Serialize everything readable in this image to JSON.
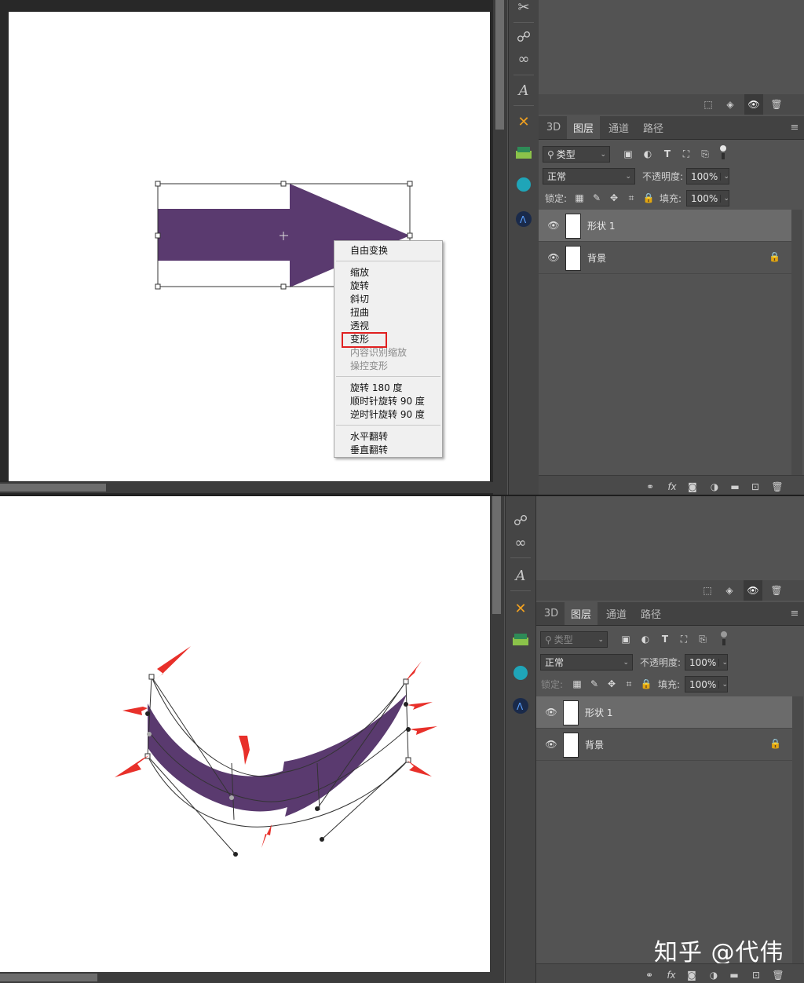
{
  "colors": {
    "arrow_fill": "#5a3a6f",
    "annotation_red": "#e8302a",
    "panel_bg": "#535353",
    "selected_layer": "#6b6b6b",
    "highlight_box": "#e02020"
  },
  "icons": {
    "tools": [
      "tool-brush-icon",
      "tool-path-icon",
      "tool-cc-icon",
      "tool-type-icon",
      "tool-brushes-icon",
      "tool-layers3d-icon",
      "tool-ball-icon",
      "tool-app-icon"
    ],
    "layer_filters": [
      "image-filter-icon",
      "adjustment-filter-icon",
      "type-filter-icon",
      "shape-filter-icon",
      "smartobject-filter-icon",
      "filter-toggle-icon"
    ],
    "bottom_bar": [
      "link-icon",
      "fx-icon",
      "mask-icon",
      "adjustment-icon",
      "folder-icon",
      "new-layer-icon",
      "trash-icon"
    ]
  },
  "top": {
    "context_menu": {
      "items_group1": [
        "自由变换"
      ],
      "items_group2": [
        "缩放",
        "旋转",
        "斜切",
        "扭曲",
        "透视",
        "变形"
      ],
      "items_group2_disabled": [
        "内容识别缩放",
        "操控变形"
      ],
      "items_group3": [
        "旋转 180 度",
        "顺时针旋转 90 度",
        "逆时针旋转 90 度"
      ],
      "items_group4": [
        "水平翻转",
        "垂直翻转"
      ],
      "highlighted": "变形"
    },
    "layers_panel": {
      "tabs": [
        "3D",
        "图层",
        "通道",
        "路径"
      ],
      "active_tab": "图层",
      "filter_label": "类型",
      "blend_mode": "正常",
      "opacity_label": "不透明度:",
      "opacity_value": "100%",
      "lock_label": "锁定:",
      "fill_label": "填充:",
      "fill_value": "100%",
      "layers": [
        {
          "name": "形状 1",
          "selected": true
        },
        {
          "name": "背景",
          "selected": false,
          "locked": true
        }
      ]
    }
  },
  "bottom": {
    "layers_panel": {
      "tabs": [
        "3D",
        "图层",
        "通道",
        "路径"
      ],
      "active_tab": "图层",
      "filter_label": "类型",
      "blend_mode": "正常",
      "opacity_label": "不透明度:",
      "opacity_value": "100%",
      "lock_label": "锁定:",
      "fill_label": "填充:",
      "fill_value": "100%",
      "layers": [
        {
          "name": "形状 1",
          "selected": true
        },
        {
          "name": "背景",
          "selected": false,
          "locked": true
        }
      ]
    },
    "watermark": "知乎 @代伟"
  }
}
